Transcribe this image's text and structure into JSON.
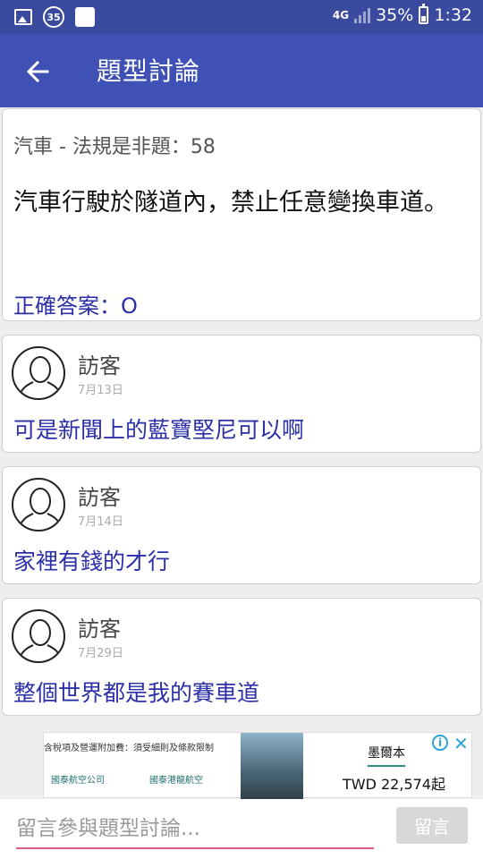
{
  "status_bar": {
    "notification_badge": "35",
    "network": "4G",
    "battery": "35%",
    "time": "1:32"
  },
  "app_bar": {
    "title": "題型討論"
  },
  "question": {
    "category": "汽車 - 法規是非題：58",
    "text": "汽車行駛於隧道內，禁止任意變換車道。",
    "answer": "正確答案：O"
  },
  "comments": [
    {
      "author": "訪客",
      "date": "7月13日",
      "text": "可是新聞上的藍寶堅尼可以啊"
    },
    {
      "author": "訪客",
      "date": "7月14日",
      "text": "家裡有錢的才行"
    },
    {
      "author": "訪客",
      "date": "7月29日",
      "text": "整個世界都是我的賽車道"
    }
  ],
  "ad": {
    "disclaimer": "含稅項及營運附加費：須受細則及條款限制",
    "logo1": "國泰航空公司",
    "logo2": "國泰港龍航空",
    "destination": "墨爾本",
    "price": "TWD 22,574起"
  },
  "comment_box": {
    "placeholder": "留言參與題型討論...",
    "send_label": "留言"
  }
}
